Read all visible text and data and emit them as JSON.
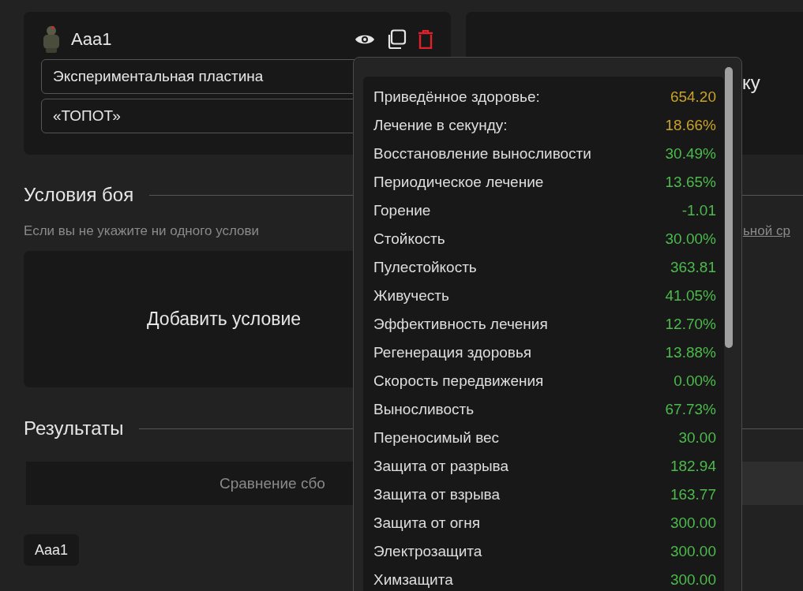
{
  "build_card": {
    "name": "Aaa1",
    "fields": [
      {
        "value": "Экспериментальная пластина"
      },
      {
        "value": "«ТОПОТ»"
      }
    ]
  },
  "side_card": {
    "text": "ку"
  },
  "conditions": {
    "title": "Условия боя",
    "hint": "Если вы не укажите ни одного услови",
    "hint_link": "ьной ср",
    "add_button": "Добавить условие"
  },
  "results": {
    "title": "Результаты",
    "comparison_tab": "Сравнение сбо",
    "chip": "Aaa1"
  },
  "stats_popup": {
    "rows": [
      {
        "label": "Приведённое здоровье:",
        "value": "654.20",
        "color": "#c9a227"
      },
      {
        "label": "Лечение в секунду:",
        "value": "18.66%",
        "color": "#c9a227"
      },
      {
        "label": "Восстановление выносливости",
        "value": "30.49%",
        "color": "#4cba4c"
      },
      {
        "label": "Периодическое лечение",
        "value": "13.65%",
        "color": "#4cba4c"
      },
      {
        "label": "Горение",
        "value": "-1.01",
        "color": "#4cba4c"
      },
      {
        "label": "Стойкость",
        "value": "30.00%",
        "color": "#4cba4c"
      },
      {
        "label": "Пулестойкость",
        "value": "363.81",
        "color": "#4cba4c"
      },
      {
        "label": "Живучесть",
        "value": "41.05%",
        "color": "#4cba4c"
      },
      {
        "label": "Эффективность лечения",
        "value": "12.70%",
        "color": "#4cba4c"
      },
      {
        "label": "Регенерация здоровья",
        "value": "13.88%",
        "color": "#4cba4c"
      },
      {
        "label": "Скорость передвижения",
        "value": "0.00%",
        "color": "#4cba4c"
      },
      {
        "label": "Выносливость",
        "value": "67.73%",
        "color": "#4cba4c"
      },
      {
        "label": "Переносимый вес",
        "value": "30.00",
        "color": "#4cba4c"
      },
      {
        "label": "Защита от разрыва",
        "value": "182.94",
        "color": "#4cba4c"
      },
      {
        "label": "Защита от взрыва",
        "value": "163.77",
        "color": "#4cba4c"
      },
      {
        "label": "Защита от огня",
        "value": "300.00",
        "color": "#4cba4c"
      },
      {
        "label": "Электрозащита",
        "value": "300.00",
        "color": "#4cba4c"
      },
      {
        "label": "Химзащита",
        "value": "300.00",
        "color": "#4cba4c"
      }
    ]
  }
}
